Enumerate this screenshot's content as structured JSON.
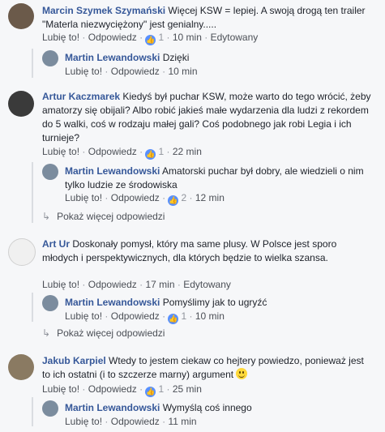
{
  "comments": [
    {
      "author": "Marcin Szymek Szymański",
      "text": "Więcej KSW = lepiej. A swoją drogą ten trailer \"Materla niezwyciężony\" jest genialny.....",
      "like": "Lubię to!",
      "reply": "Odpowiedz",
      "likes": "1",
      "time": "10 min",
      "edited": "Edytowany",
      "replies": [
        {
          "author": "Martin Lewandowski",
          "text": "Dzięki",
          "like": "Lubię to!",
          "reply": "Odpowiedz",
          "time": "10 min"
        }
      ]
    },
    {
      "author": "Artur Kaczmarek",
      "text": "Kiedyś był puchar KSW, może warto do tego wrócić, żeby amatorzy się obijali? Albo robić jakieś małe wydarzenia dla ludzi z rekordem do 5 walki, coś w rodzaju małej gali? Coś podobnego jak robi Legia i ich turnieje?",
      "like": "Lubię to!",
      "reply": "Odpowiedz",
      "likes": "1",
      "time": "22 min",
      "replies": [
        {
          "author": "Martin Lewandowski",
          "text": "Amatorski puchar był dobry, ale wiedzieli o nim tylko ludzie ze środowiska",
          "like": "Lubię to!",
          "reply": "Odpowiedz",
          "likes": "2",
          "time": "12 min"
        }
      ],
      "more": "Pokaż więcej odpowiedzi"
    },
    {
      "author": "Art Ur",
      "text": "Doskonały pomysł, który ma same plusy. W Polsce jest sporo młodych i perspektywicznych, dla których będzie to wielka szansa.",
      "like": "Lubię to!",
      "reply": "Odpowiedz",
      "time": "17 min",
      "edited": "Edytowany",
      "replies": [
        {
          "author": "Martin Lewandowski",
          "text": "Pomyślimy jak to ugryźć",
          "like": "Lubię to!",
          "reply": "Odpowiedz",
          "likes": "1",
          "time": "10 min"
        }
      ],
      "more": "Pokaż więcej odpowiedzi"
    },
    {
      "author": "Jakub Karpiel",
      "text": "Wtedy to jestem ciekaw co hejtery powiedzo, ponieważ jest to ich ostatni (i to szczerze marny) argument",
      "like": "Lubię to!",
      "reply": "Odpowiedz",
      "likes": "1",
      "time": "25 min",
      "replies": [
        {
          "author": "Martin Lewandowski",
          "text": "Wymyślą coś innego",
          "like": "Lubię to!",
          "reply": "Odpowiedz",
          "time": "11 min"
        }
      ]
    }
  ],
  "ui": {
    "dot": "·",
    "like_icon": "thumbs-up-icon",
    "accent": "#365899",
    "like_color": "#5890ff"
  }
}
